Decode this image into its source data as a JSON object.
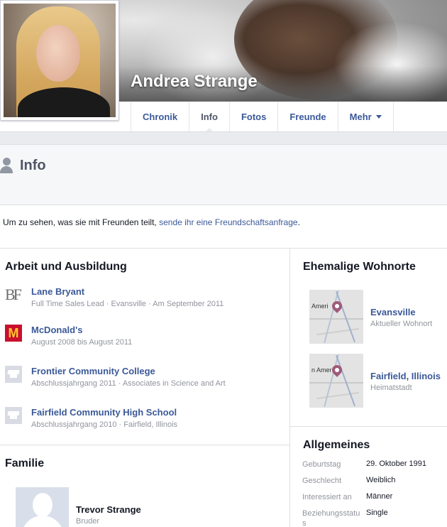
{
  "profile": {
    "name": "Andrea Strange"
  },
  "tabs": [
    {
      "label": "Chronik"
    },
    {
      "label": "Info"
    },
    {
      "label": "Fotos"
    },
    {
      "label": "Freunde"
    },
    {
      "label": "Mehr"
    }
  ],
  "info_header": {
    "title": "Info"
  },
  "friend_notice": {
    "text": "Um zu sehen, was sie mit Freunden teilt, ",
    "link": "sende ihr eine Freundschaftsanfrage",
    "suffix": "."
  },
  "work": {
    "title": "Arbeit und Ausbildung",
    "items": [
      {
        "name": "Lane Bryant",
        "sub": "Full Time Sales Lead · Evansville · Am September 2011",
        "logo": "BF"
      },
      {
        "name": "McDonald's",
        "sub": "August 2008 bis August 2011",
        "logo": "M"
      },
      {
        "name": "Frontier Community College",
        "sub": "Abschlussjahrgang 2011 · Associates in Science and Art",
        "logo": "school-icon"
      },
      {
        "name": "Fairfield Community High School",
        "sub": "Abschlussjahrgang 2010 · Fairfield, Illinois",
        "logo": "school-icon"
      }
    ]
  },
  "places": {
    "title": "Ehemalige Wohnorte",
    "items": [
      {
        "name": "Evansville",
        "sub": "Aktueller Wohnort",
        "map_label": "Ameri"
      },
      {
        "name": "Fairfield, Illinois",
        "sub": "Heimatstadt",
        "map_label": "n Amer"
      }
    ]
  },
  "general": {
    "title": "Allgemeines",
    "rows": [
      {
        "label": "Geburtstag",
        "value": "29. Oktober 1991"
      },
      {
        "label": "Geschlecht",
        "value": "Weiblich"
      },
      {
        "label": "Interessiert an",
        "value": "Männer"
      },
      {
        "label": "Beziehungsstatus",
        "value": "Single"
      }
    ]
  },
  "family": {
    "title": "Familie",
    "members": [
      {
        "name": "Trevor Strange",
        "relation": "Bruder"
      }
    ]
  },
  "colors": {
    "link": "#3b5998",
    "muted": "#90949c",
    "border": "#dddfe2",
    "band": "#f6f7f9",
    "pin": "#a05a7a",
    "mcdonalds_red": "#c8102e",
    "mcdonalds_yellow": "#ffc72c"
  }
}
